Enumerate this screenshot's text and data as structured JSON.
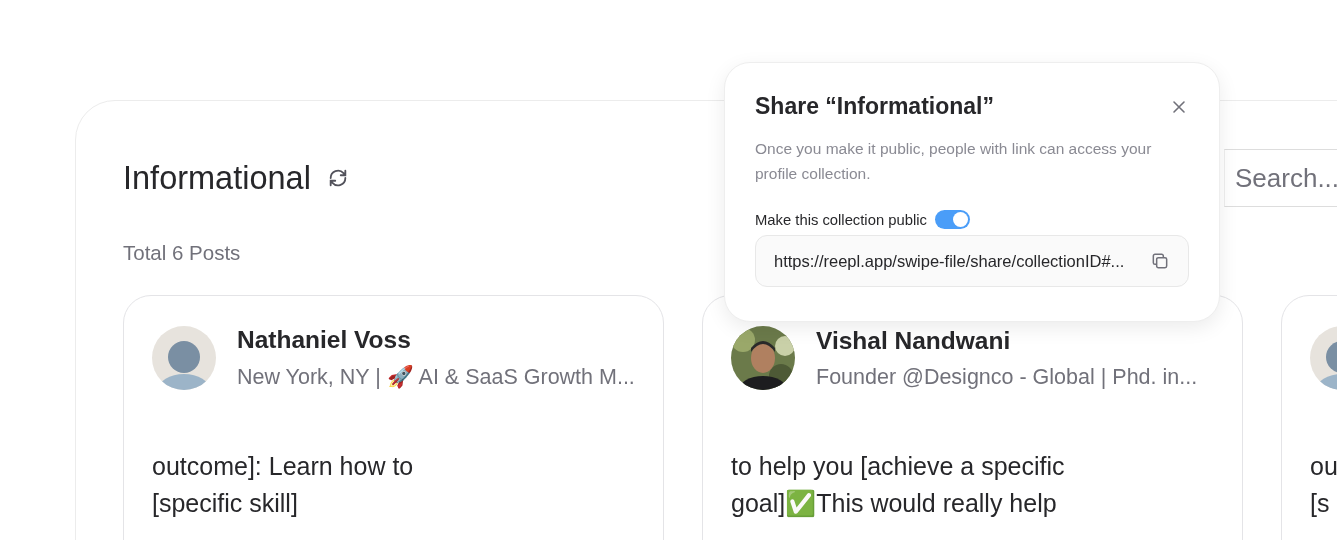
{
  "collection": {
    "title": "Informational",
    "total": "Total 6 Posts"
  },
  "search": {
    "placeholder": "Search..."
  },
  "posts": [
    {
      "author": "Nathaniel Voss",
      "headline": "New York, NY | 🚀 AI & SaaS Growth M...",
      "avatar": {
        "kind": "placeholder"
      },
      "lines": [
        "outcome]: Learn how to",
        "[specific skill]"
      ]
    },
    {
      "author": "Vishal Nandwani",
      "headline": "Founder @Designco - Global | Phd. in...",
      "avatar": {
        "kind": "picture"
      },
      "lines": [
        "to help you [achieve a specific",
        "goal]✅This would really help"
      ]
    },
    {
      "avatar": {
        "kind": "placeholder"
      },
      "lines": [
        "ou",
        "[s"
      ]
    }
  ],
  "share_dialog": {
    "title": "Share “Informational”",
    "description": "Once you make it public, people with link can access your profile collection.",
    "public_label": "Make this collection public",
    "public": true,
    "link": "https://reepl.app/swipe-file/share/collectionID#..."
  }
}
